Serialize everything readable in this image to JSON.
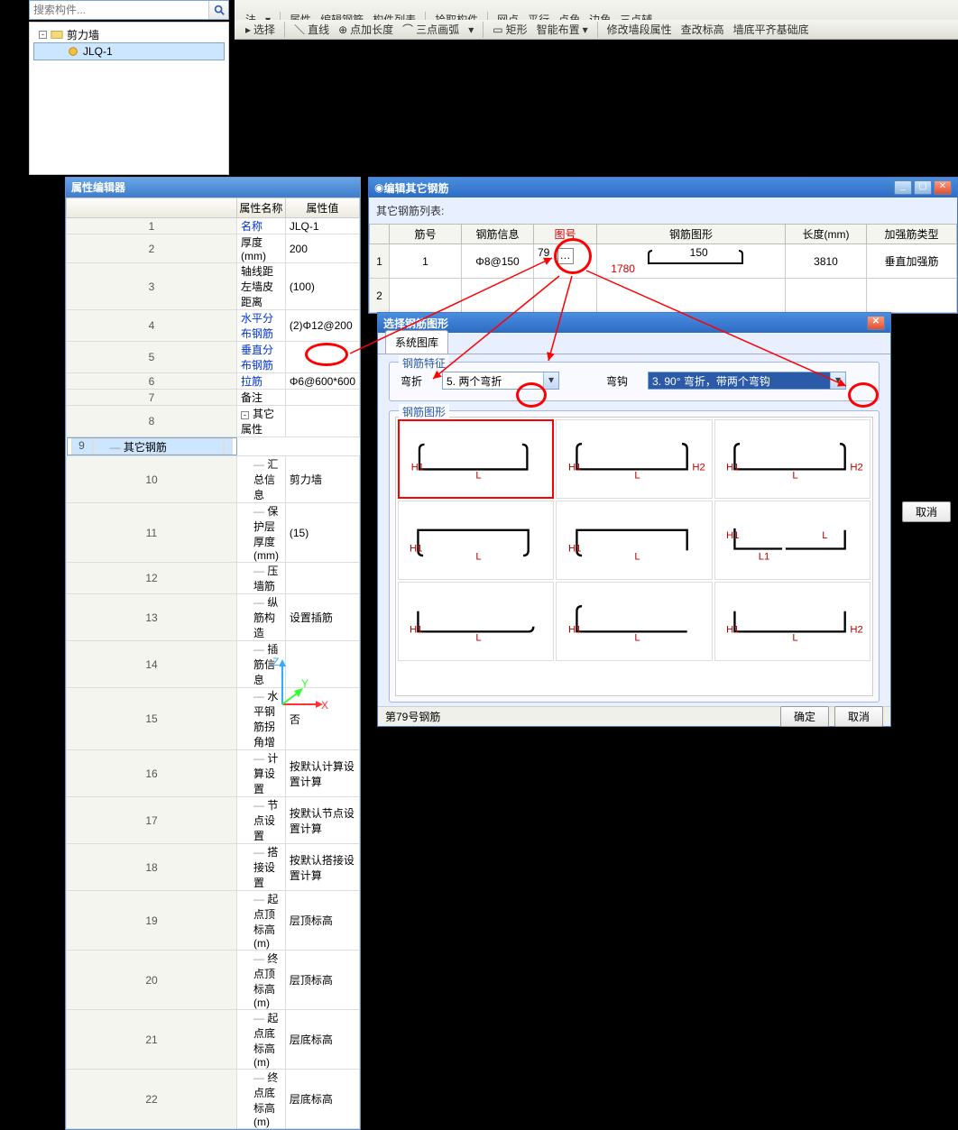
{
  "search": {
    "placeholder": "搜索构件..."
  },
  "tree": {
    "root_label": "剪力墙",
    "child_label": "JLQ-1"
  },
  "prop_panel": {
    "title": "属性编辑器",
    "col_name": "属性名称",
    "col_value": "属性值",
    "rows": [
      {
        "n": "1",
        "name": "名称",
        "val": "JLQ-1",
        "blue": true
      },
      {
        "n": "2",
        "name": "厚度(mm)",
        "val": "200"
      },
      {
        "n": "3",
        "name": "轴线距左墙皮距离",
        "val": "(100)"
      },
      {
        "n": "4",
        "name": "水平分布钢筋",
        "val": "(2)Φ12@200",
        "blue": true
      },
      {
        "n": "5",
        "name": "垂直分布钢筋",
        "val": "",
        "blue": true
      },
      {
        "n": "6",
        "name": "拉筋",
        "val": "Φ6@600*600",
        "blue": true
      },
      {
        "n": "7",
        "name": "备注",
        "val": ""
      },
      {
        "n": "8",
        "name": "其它属性",
        "val": "",
        "exp": true
      },
      {
        "n": "9",
        "name": "其它钢筋",
        "val": "",
        "indent": true,
        "sel": true
      },
      {
        "n": "10",
        "name": "汇总信息",
        "val": "剪力墙",
        "indent": true
      },
      {
        "n": "11",
        "name": "保护层厚度(mm)",
        "val": "(15)",
        "indent": true
      },
      {
        "n": "12",
        "name": "压墙筋",
        "val": "",
        "indent": true
      },
      {
        "n": "13",
        "name": "纵筋构造",
        "val": "设置插筋",
        "indent": true
      },
      {
        "n": "14",
        "name": "插筋信息",
        "val": "",
        "indent": true
      },
      {
        "n": "15",
        "name": "水平钢筋拐角增",
        "val": "否",
        "indent": true
      },
      {
        "n": "16",
        "name": "计算设置",
        "val": "按默认计算设置计算",
        "indent": true
      },
      {
        "n": "17",
        "name": "节点设置",
        "val": "按默认节点设置计算",
        "indent": true
      },
      {
        "n": "18",
        "name": "搭接设置",
        "val": "按默认搭接设置计算",
        "indent": true
      },
      {
        "n": "19",
        "name": "起点顶标高(m)",
        "val": "层顶标高",
        "indent": true
      },
      {
        "n": "20",
        "name": "终点顶标高(m)",
        "val": "层顶标高",
        "indent": true
      },
      {
        "n": "21",
        "name": "起点底标高(m)",
        "val": "层底标高",
        "indent": true
      },
      {
        "n": "22",
        "name": "终点底标高(m)",
        "val": "层底标高",
        "indent": true
      }
    ]
  },
  "edit_dlg": {
    "title": "编辑其它钢筋",
    "list_label": "其它钢筋列表:",
    "cols": {
      "c1": "筋号",
      "c2": "钢筋信息",
      "c3": "图号",
      "c4": "钢筋图形",
      "c5": "长度(mm)",
      "c6": "加强筋类型"
    },
    "row": {
      "num": "1",
      "jh": "1",
      "info": "Φ8@150",
      "fig": "79",
      "shape_dim": "150",
      "shape_h": "1780",
      "len": "3810",
      "type": "垂直加强筋"
    }
  },
  "shape_dlg": {
    "title": "选择钢筋图形",
    "tab": "系统图库",
    "group_filter": "钢筋特征",
    "lbl_bend": "弯折",
    "sel_bend": "5. 两个弯折",
    "lbl_hook": "弯钩",
    "sel_hook": "3. 90° 弯折，带两个弯钩",
    "group_shape": "钢筋图形",
    "status": "第79号钢筋",
    "btn_ok": "确定",
    "btn_cancel": "取消"
  },
  "outer_cancel": "取消",
  "toolbar": {
    "row1": [
      "法",
      "属性",
      "编辑钢筋",
      "构件列表",
      "拾取构件",
      "网点",
      "平行",
      "点角",
      "边角",
      "三点辅"
    ],
    "row2": [
      "选择",
      "直线",
      "点加长度",
      "三点画弧",
      "矩形",
      "智能布置",
      "修改墙段属性",
      "查改标高",
      "墙底平齐基础底"
    ]
  },
  "axis": {
    "x": "X",
    "y": "Y",
    "z": "Z"
  }
}
